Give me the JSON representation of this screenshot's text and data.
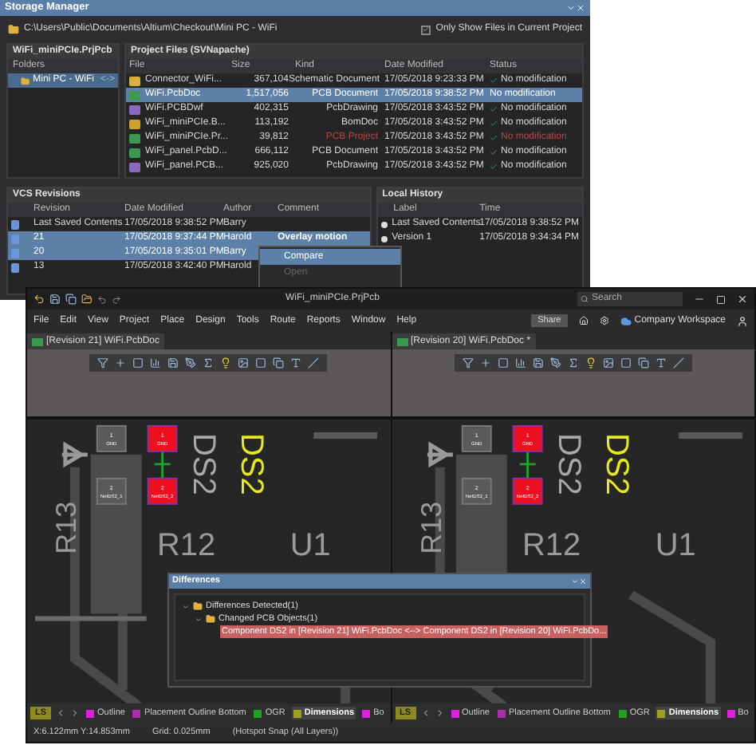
{
  "storage_manager": {
    "title": "Storage Manager",
    "path": "C:\\Users\\Public\\Documents\\Altium\\Checkout\\Mini PC - WiFi",
    "only_show_current": {
      "label": "Only Show Files in Current Project",
      "checked": true
    },
    "project": {
      "title": "WiFi_miniPCIe.PrjPcb",
      "folders_label": "Folders",
      "folders": [
        {
          "label": "Mini PC - WiFi",
          "badge": "<->",
          "selected": true
        }
      ]
    },
    "files": {
      "title": "Project Files (SVNapache)",
      "columns": [
        "File",
        "Size",
        "Kind",
        "Date Modified",
        "Status"
      ],
      "rows": [
        {
          "kind": "schematic",
          "name": "Connector_WiFi...",
          "size": "367,104",
          "type": "Schematic Document",
          "date": "17/05/2018 9:23:33 PM",
          "status": "No modification",
          "selected": false,
          "flagged": false
        },
        {
          "kind": "pcb",
          "name": "WiFi.PcbDoc",
          "size": "1,517,056",
          "type": "PCB Document",
          "date": "17/05/2018 9:38:52 PM",
          "status": "No modification",
          "selected": true,
          "flagged": false
        },
        {
          "kind": "drawing",
          "name": "WiFi.PCBDwf",
          "size": "402,315",
          "type": "PcbDrawing",
          "date": "17/05/2018 3:43:52 PM",
          "status": "No modification",
          "selected": false,
          "flagged": false
        },
        {
          "kind": "bom",
          "name": "WiFi_miniPCIe.B...",
          "size": "113,192",
          "type": "BomDoc",
          "date": "17/05/2018 3:43:52 PM",
          "status": "No modification",
          "selected": false,
          "flagged": false
        },
        {
          "kind": "project",
          "name": "WiFi_miniPCIe.Pr...",
          "size": "39,812",
          "type": "PCB Project",
          "date": "17/05/2018 3:43:52 PM",
          "status": "No modification",
          "selected": false,
          "flagged": true
        },
        {
          "kind": "pcb",
          "name": "WiFi_panel.PcbD...",
          "size": "666,112",
          "type": "PCB Document",
          "date": "17/05/2018 3:43:52 PM",
          "status": "No modification",
          "selected": false,
          "flagged": false
        },
        {
          "kind": "drawing",
          "name": "WiFi_panel.PCB...",
          "size": "925,020",
          "type": "PcbDrawing",
          "date": "17/05/2018 3:43:52 PM",
          "status": "No modification",
          "selected": false,
          "flagged": false
        }
      ]
    },
    "vcs": {
      "title": "VCS Revisions",
      "columns": [
        "Revision",
        "Date Modified",
        "Author",
        "Comment"
      ],
      "rows": [
        {
          "revision": "Last Saved Contents",
          "date": "17/05/2018 9:38:52 PM",
          "author": "Barry",
          "comment": "",
          "selected": false
        },
        {
          "revision": "21",
          "date": "17/05/2018 9:37:44 PM",
          "author": "Harold",
          "comment": "Overlay motion",
          "selected": true
        },
        {
          "revision": "20",
          "date": "17/05/2018 9:35:01 PM",
          "author": "Barry",
          "comment": "",
          "selected": true
        },
        {
          "revision": "13",
          "date": "17/05/2018 3:42:40 PM",
          "author": "Harold",
          "comment": "",
          "selected": false
        }
      ]
    },
    "local_history": {
      "title": "Local History",
      "columns": [
        "Label",
        "Time"
      ],
      "rows": [
        {
          "label": "Last Saved Contents",
          "time": "17/05/2018 9:38:52 PM"
        },
        {
          "label": "Version 1",
          "time": "17/05/2018 9:34:34 PM"
        }
      ]
    },
    "context_menu": [
      {
        "label": "Compare",
        "selected": true,
        "disabled": false
      },
      {
        "label": "Open",
        "selected": false,
        "disabled": true
      }
    ]
  },
  "main_window": {
    "title": "WiFi_miniPCIe.PrjPcb",
    "search": {
      "placeholder": "Search"
    },
    "menu": [
      "File",
      "Edit",
      "View",
      "Project",
      "Place",
      "Design",
      "Tools",
      "Route",
      "Reports",
      "Window",
      "Help"
    ],
    "share": "Share",
    "workspace": "Company Workspace",
    "panes": [
      {
        "tab": "[Revision 21] WiFi.PcbDoc",
        "labels": [
          "DS2",
          "DS2",
          "R13",
          "R12",
          "U1"
        ],
        "pads": [
          {
            "number": "1",
            "net": "GND",
            "selected": false
          },
          {
            "number": "1",
            "net": "GND",
            "selected": true
          },
          {
            "number": "2",
            "net": "NetDS2_1",
            "selected": false
          },
          {
            "number": "2",
            "net": "NetDS2_2",
            "selected": true
          }
        ],
        "layer_set": "LS",
        "layers": [
          {
            "name": "Outline",
            "color": "#e01ee0",
            "selected": false
          },
          {
            "name": "Placement Outline Bottom",
            "color": "#b02ab0",
            "selected": false
          },
          {
            "name": "OGR",
            "color": "#22a022",
            "selected": false
          },
          {
            "name": "Dimensions",
            "color": "#a0a020",
            "selected": true
          },
          {
            "name": "Bo",
            "color": "#e01ee0",
            "selected": false
          }
        ]
      },
      {
        "tab": "[Revision 20] WiFi.PcbDoc *",
        "labels": [
          "DS2",
          "DS2",
          "R13",
          "R12",
          "U1"
        ],
        "pads": [
          {
            "number": "1",
            "net": "GND",
            "selected": false
          },
          {
            "number": "1",
            "net": "GND",
            "selected": true
          },
          {
            "number": "2",
            "net": "NetDS2_1",
            "selected": false
          },
          {
            "number": "2",
            "net": "NetDS2_2",
            "selected": true
          }
        ],
        "layer_set": "LS",
        "layers": [
          {
            "name": "Outline",
            "color": "#e01ee0",
            "selected": false
          },
          {
            "name": "Placement Outline Bottom",
            "color": "#b02ab0",
            "selected": false
          },
          {
            "name": "OGR",
            "color": "#22a022",
            "selected": false
          },
          {
            "name": "Dimensions",
            "color": "#a0a020",
            "selected": true
          },
          {
            "name": "Bo",
            "color": "#e01ee0",
            "selected": false
          }
        ]
      }
    ],
    "differences": {
      "title": "Differences",
      "tree": [
        {
          "label": "Differences Detected(1)",
          "expanded": true,
          "children": [
            {
              "label": "Changed PCB Objects(1)",
              "expanded": true,
              "children": [
                {
                  "label": "Component DS2 in [Revision 21] WiFi.PcbDoc <--> Component DS2 in [Revision 20] WiFi.PcbDo...",
                  "selected": true
                }
              ]
            }
          ]
        }
      ]
    },
    "status_bar": [
      "X:6.122mm Y:14.853mm",
      "Grid: 0.025mm",
      "(Hotspot Snap (All Layers))"
    ]
  }
}
